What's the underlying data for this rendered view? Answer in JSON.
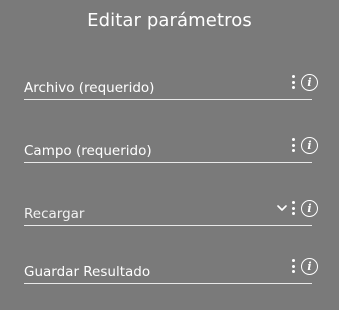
{
  "dialog": {
    "title": "Editar parámetros"
  },
  "fields": [
    {
      "label": "Archivo (requerido)",
      "icons": [
        "more-vert-icon",
        "info-icon"
      ]
    },
    {
      "label": "Campo (requerido)",
      "icons": [
        "more-vert-icon",
        "info-icon"
      ]
    },
    {
      "label": "Recargar",
      "icons": [
        "chevron-down-icon",
        "more-vert-icon",
        "info-icon"
      ]
    },
    {
      "label": "Guardar Resultado",
      "icons": [
        "more-vert-icon",
        "info-icon"
      ]
    }
  ],
  "info_glyph": "i",
  "colors": {
    "background": "#7a7a7a",
    "text": "#ffffff",
    "underline": "#e9e9e9"
  }
}
